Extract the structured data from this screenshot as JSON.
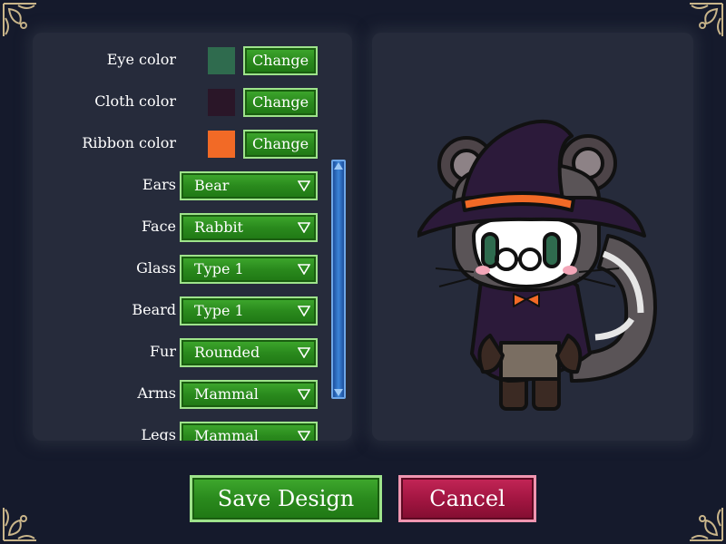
{
  "colors": {
    "background": "#151a2c",
    "panel": "#262b3b",
    "green_button": "#2a8a1d",
    "red_button": "#a31642",
    "scrollbar": "#2f6fc0",
    "ornament": "#c9b58a"
  },
  "color_options": [
    {
      "label": "Eye color",
      "swatch": "#2f6b4e",
      "button": "Change"
    },
    {
      "label": "Cloth color",
      "swatch": "#2a1628",
      "button": "Change"
    },
    {
      "label": "Ribbon color",
      "swatch": "#f26a26",
      "button": "Change"
    }
  ],
  "part_options": [
    {
      "label": "Ears",
      "value": "Bear"
    },
    {
      "label": "Face",
      "value": "Rabbit"
    },
    {
      "label": "Glass",
      "value": "Type 1"
    },
    {
      "label": "Beard",
      "value": "Type 1"
    },
    {
      "label": "Fur",
      "value": "Rounded"
    },
    {
      "label": "Arms",
      "value": "Mammal"
    },
    {
      "label": "Legs",
      "value": "Mammal"
    }
  ],
  "buttons": {
    "save": "Save Design",
    "cancel": "Cancel"
  }
}
